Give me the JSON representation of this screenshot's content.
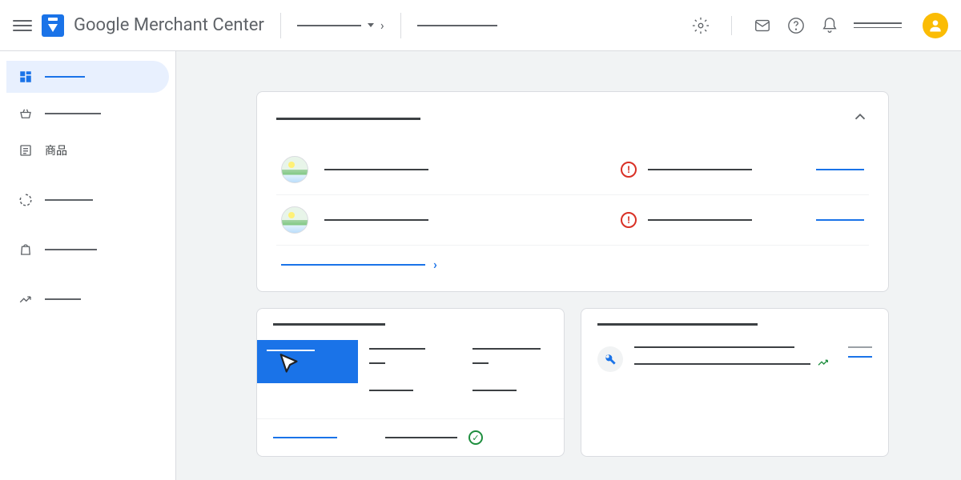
{
  "header": {
    "app_title": "Google Merchant Center"
  },
  "sidebar": {
    "items": [
      {
        "label": "",
        "icon": "dashboard"
      },
      {
        "label": "",
        "icon": "basket"
      },
      {
        "label": "商品",
        "icon": "list"
      },
      {
        "label": "",
        "icon": "progress"
      },
      {
        "label": "",
        "icon": "bag"
      },
      {
        "label": "",
        "icon": "trend"
      }
    ]
  },
  "feeds": {
    "title": "",
    "rows": [
      {
        "status": "error",
        "action": ""
      },
      {
        "status": "error",
        "action": ""
      }
    ],
    "view_all": ""
  },
  "stats_card": {
    "title": ""
  },
  "insights_card": {
    "title": ""
  }
}
